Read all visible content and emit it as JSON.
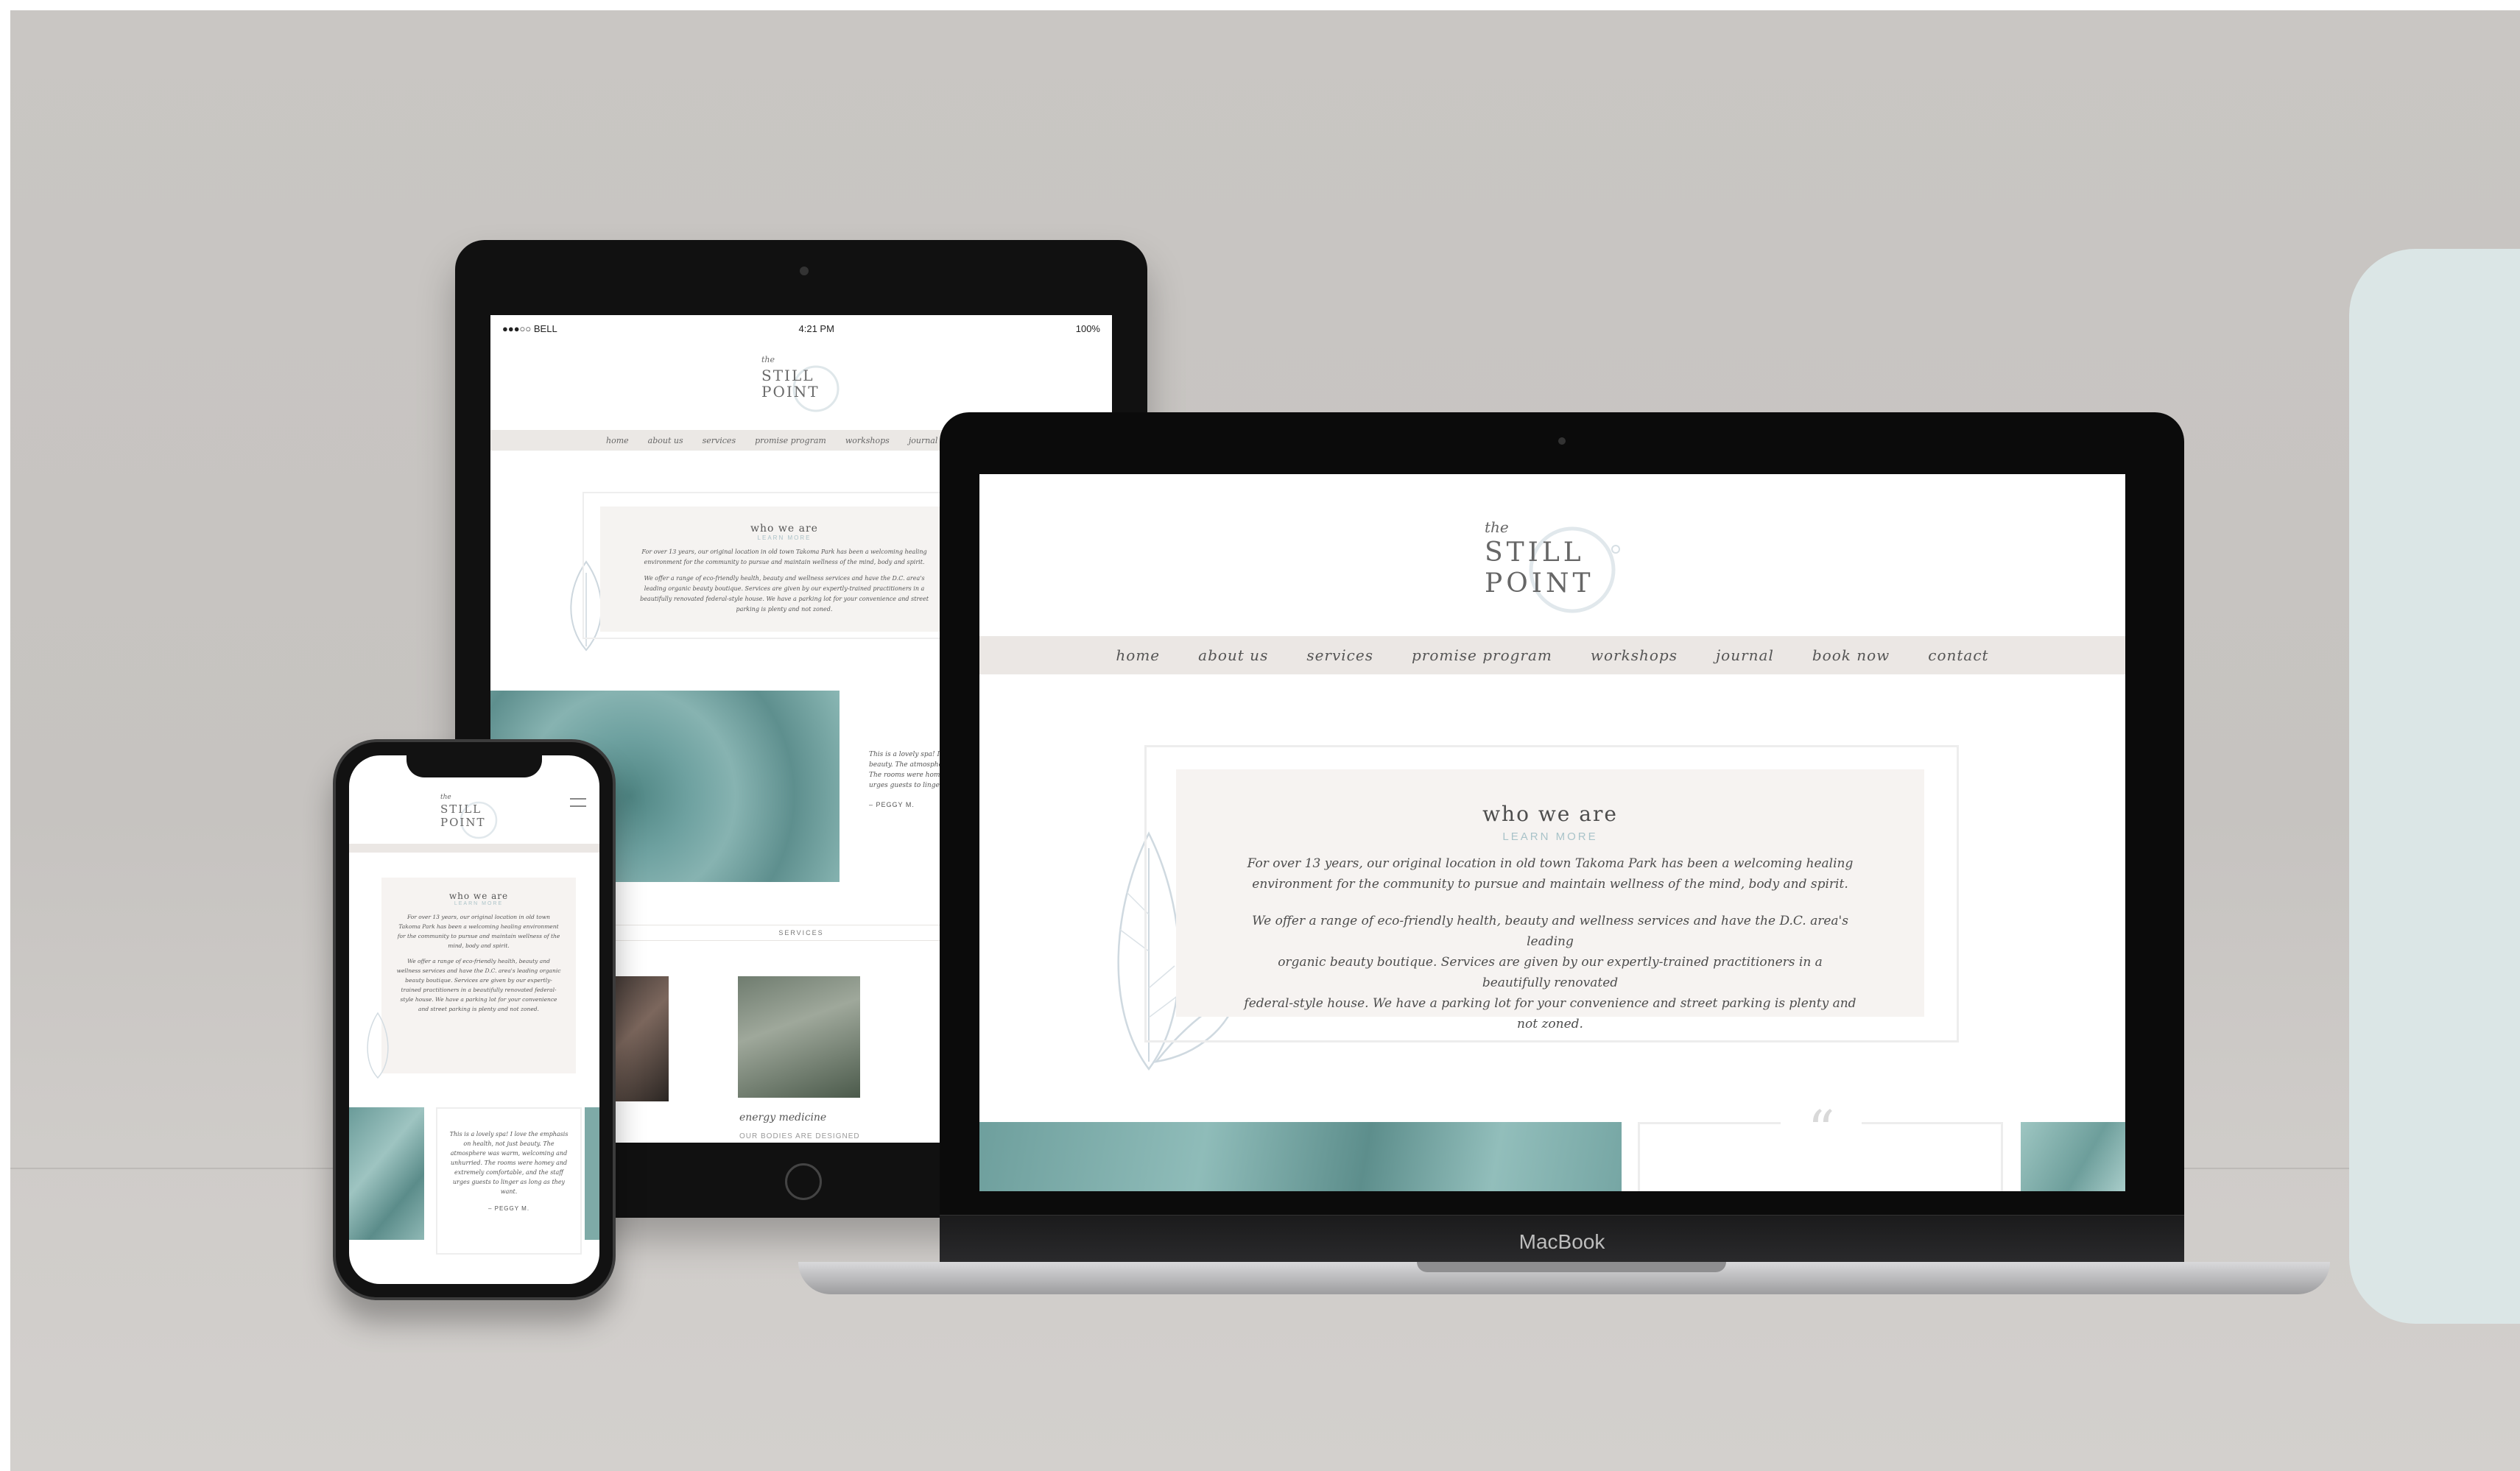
{
  "brand": {
    "the": "the",
    "line1": "STILL",
    "line2": "POINT"
  },
  "nav": [
    "home",
    "about us",
    "services",
    "promise program",
    "workshops",
    "journal",
    "book now",
    "contact"
  ],
  "about": {
    "title": "who we are",
    "learn_more": "LEARN MORE",
    "para1_line1": "For over 13 years, our original location in old town Takoma Park has been a welcoming healing",
    "para1_line2": "environment for the community to pursue and maintain wellness of the mind, body and spirit.",
    "para2_line1": "We offer a range of eco-friendly health, beauty and wellness services and have the D.C. area's leading",
    "para2_line2": "organic beauty boutique. Services are given by our expertly-trained practitioners in a beautifully renovated",
    "para2_line3": "federal-style house. We have a parking lot for your convenience and street parking is plenty and not zoned."
  },
  "laptop": {
    "label": "MacBook",
    "quote_mark": "“"
  },
  "tablet": {
    "status_carrier": "●●●○○ BELL",
    "status_time": "4:21 PM",
    "status_battery": "100%",
    "services_label": "SERVICES",
    "service_caption": "energy medicine",
    "service_sub": "OUR BODIES ARE DESIGNED",
    "quote_text": "This is a lovely spa! I love the emphasis on health, not just beauty. The atmosphere was warm, welcoming and unhurried. The rooms were homey and extremely comfortable, and the staff urges guests to linger as long as they want.",
    "quote_author": "– PEGGY M."
  },
  "colors": {
    "accent": "#a9c3c9",
    "nav_bg": "#ebe7e4",
    "card_bg": "#f6f3f1",
    "mint": "#dbe6e6"
  }
}
